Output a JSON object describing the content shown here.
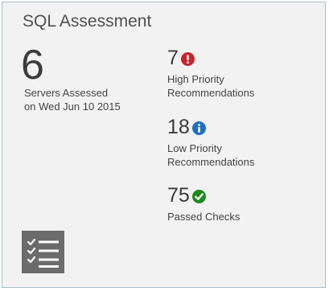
{
  "tile": {
    "title": "SQL Assessment",
    "servers": {
      "count": "6",
      "label_line1": "Servers Assessed",
      "label_line2": "on Wed Jun 10 2015"
    },
    "stats": {
      "high": {
        "value": "7",
        "label_line1": "High Priority",
        "label_line2": "Recommendations",
        "icon": "error-icon",
        "color": "#c8242b"
      },
      "low": {
        "value": "18",
        "label_line1": "Low Priority",
        "label_line2": "Recommendations",
        "icon": "info-icon",
        "color": "#1f6fc0"
      },
      "passed": {
        "value": "75",
        "label_line1": "Passed Checks",
        "icon": "check-icon",
        "color": "#1e8a1e"
      }
    },
    "app_icon": "checklist-icon"
  }
}
